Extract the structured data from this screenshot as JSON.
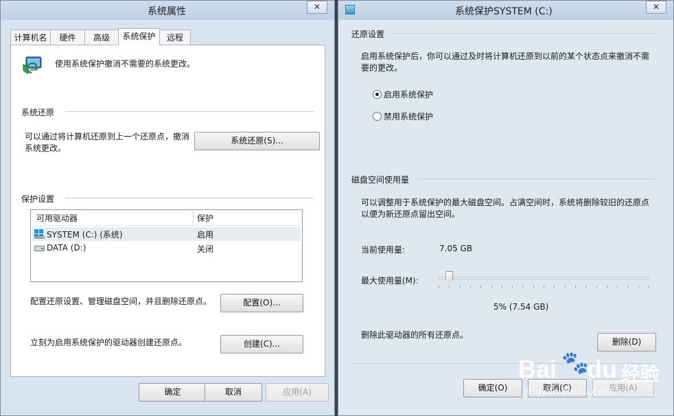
{
  "left_window": {
    "title": "系统属性",
    "close": "✕",
    "tabs": [
      "计算机名",
      "硬件",
      "高级",
      "系统保护",
      "远程"
    ],
    "active_tab": 3,
    "intro": "使用系统保护撤消不需要的系统更改。",
    "restore_section": {
      "heading": "系统还原",
      "description": "可以通过将计算机还原到上一个还原点，撤消系统更改。",
      "button": "系统还原(S)..."
    },
    "protection_section": {
      "heading": "保护设置",
      "columns": [
        "可用驱动器",
        "保护"
      ],
      "rows": [
        {
          "drive": "SYSTEM (C:) (系统)",
          "status": "启用"
        },
        {
          "drive": "DATA (D:)",
          "status": "关闭"
        }
      ],
      "configure_text": "配置还原设置、管理磁盘空间，并且删除还原点。",
      "configure_button": "配置(O)...",
      "create_text": "立刻为启用系统保护的驱动器创建还原点。",
      "create_button": "创建(C)..."
    },
    "footer": {
      "ok": "确定",
      "cancel": "取消",
      "apply": "应用(A)"
    }
  },
  "right_window": {
    "title": "系统保护SYSTEM (C:)",
    "close": "✕",
    "restore_settings": {
      "heading": "还原设置",
      "description": "启用系统保护后，你可以通过及时将计算机还原到以前的某个状态点来撤消不需要的更改。",
      "option_on": "启用系统保护",
      "option_off": "禁用系统保护",
      "selected": "启用系统保护"
    },
    "disk_usage": {
      "heading": "磁盘空间使用量",
      "description": "可以调整用于系统保护的最大磁盘空间。占满空间时，系统将删除较旧的还原点以便为新还原点留出空间。",
      "current_label": "当前使用量:",
      "current_value": "7.05 GB",
      "max_label": "最大使用量(M):",
      "slider_percent": 5,
      "slider_readout": "5% (7.54 GB)",
      "delete_text": "删除此驱动器的所有还原点。",
      "delete_button": "删除(D)"
    },
    "footer": {
      "ok": "确定(O)",
      "cancel": "取消(C)",
      "apply": "应用(A)"
    }
  },
  "watermark": {
    "brand": "Bai",
    "paw": "🐾",
    "brand2": "du",
    "cn": "经验",
    "url": "jingyan.baidu.com"
  }
}
